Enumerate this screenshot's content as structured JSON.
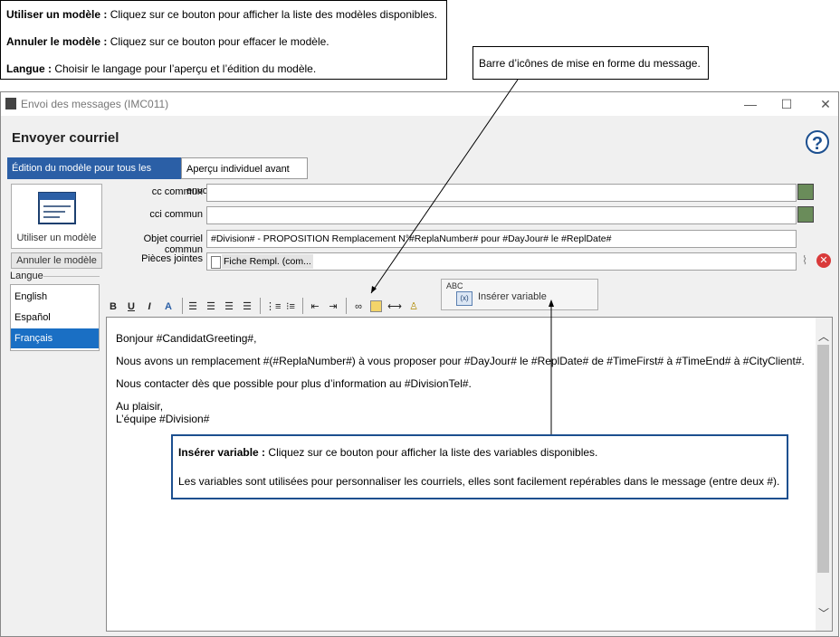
{
  "callouts": {
    "top_left": {
      "line1_bold": "Utiliser un modèle :",
      "line1_text": " Cliquez sur ce bouton pour afficher la liste des modèles disponibles.",
      "line2_bold": "Annuler le modèle :",
      "line2_text": " Cliquez sur ce bouton pour effacer le modèle.",
      "line3_bold": "Langue :",
      "line3_text": " Choisir le langage pour l’aperçu et l’édition du modèle."
    },
    "toolbar": {
      "text": "Barre d’icônes de mise en forme du message."
    },
    "variable": {
      "bold": "Insérer variable :",
      "text": " Cliquez sur ce bouton pour afficher la liste des variables disponibles.",
      "line2": "Les variables sont utilisées pour personnaliser les courriels, elles sont facilement repérables dans le message (entre deux #)."
    }
  },
  "window": {
    "title": "Envoi des messages (IMC011)",
    "heading": "Envoyer courriel",
    "help": "?",
    "tabs": [
      "Édition du modèle pour tous les contacts",
      "Aperçu individuel avant envoi"
    ]
  },
  "left": {
    "use_template": "Utiliser un modèle",
    "cancel_template": "Annuler le modèle",
    "language_label": "Langue",
    "languages": [
      "English",
      "Español",
      "Français"
    ],
    "selected_language": "Français"
  },
  "fields": {
    "cc_label": "cc commun",
    "cc_value": "",
    "cci_label": "cci commun",
    "cci_value": "",
    "subject_label": "Objet courriel commun",
    "subject_value": "#Division# - PROPOSITION Remplacement N°#ReplaNumber# pour #DayJour# le #ReplDate#",
    "attach_label": "Pièces jointes",
    "attach_value": "Fiche Rempl. (com..."
  },
  "toolbar": {
    "bold": "B",
    "underline": "U",
    "italic": "I",
    "insert_variable_abc": "ABC",
    "insert_variable": "Insérer variable"
  },
  "editor": {
    "lines": [
      "Bonjour #CandidatGreeting#,",
      "Nous avons un remplacement #(#ReplaNumber#) à vous proposer pour #DayJour# le  #ReplDate# de #TimeFirst# à #TimeEnd# à #CityClient#.",
      "Nous contacter dès que possible pour plus d’information au #DivisionTel#.",
      "Au plaisir,",
      "L’équipe #Division#"
    ]
  },
  "colors": {
    "accent": "#2b5fa6",
    "selected": "#1a6fc4",
    "callout_border": "#1c4f8f"
  }
}
